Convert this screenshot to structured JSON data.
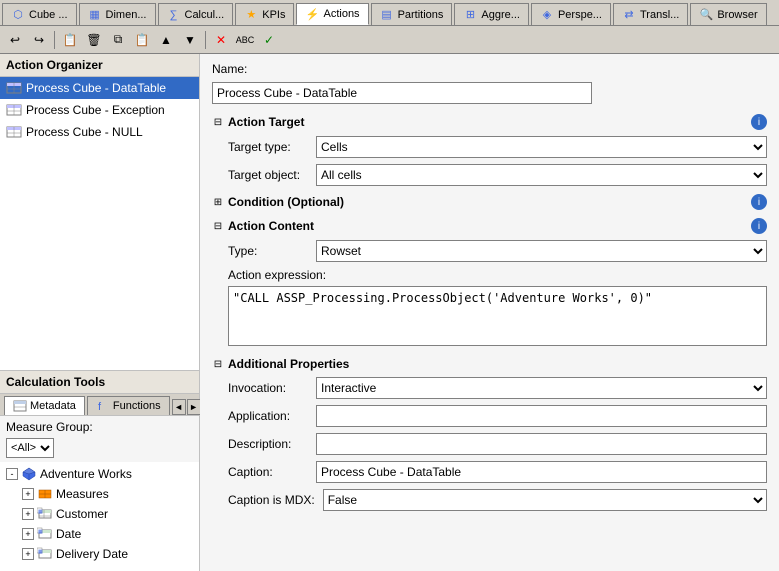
{
  "tabs": [
    {
      "label": "Cube ...",
      "icon": "cube",
      "active": false
    },
    {
      "label": "Dimen...",
      "icon": "dimension",
      "active": false
    },
    {
      "label": "Calcul...",
      "icon": "calculation",
      "active": false
    },
    {
      "label": "KPIs",
      "icon": "kpi",
      "active": false
    },
    {
      "label": "Actions",
      "icon": "action",
      "active": true
    },
    {
      "label": "Partitions",
      "icon": "partition",
      "active": false
    },
    {
      "label": "Aggre...",
      "icon": "aggregate",
      "active": false
    },
    {
      "label": "Perspe...",
      "icon": "perspective",
      "active": false
    },
    {
      "label": "Transl...",
      "icon": "translation",
      "active": false
    },
    {
      "label": "Browser",
      "icon": "browser",
      "active": false
    }
  ],
  "toolbar": {
    "buttons": [
      "↩",
      "↪",
      "📋",
      "✂",
      "📄",
      "📋",
      "🔍",
      "✕",
      "ABC"
    ]
  },
  "left_panel": {
    "organizer_title": "Action Organizer",
    "actions": [
      {
        "label": "Process Cube - DataTable",
        "selected": true
      },
      {
        "label": "Process Cube - Exception",
        "selected": false
      },
      {
        "label": "Process Cube - NULL",
        "selected": false
      }
    ],
    "calc_tools_title": "Calculation Tools",
    "calc_tabs": [
      {
        "label": "Metadata",
        "active": true,
        "icon": "metadata"
      },
      {
        "label": "Functions",
        "active": false,
        "icon": "functions"
      }
    ],
    "measure_group_label": "Measure Group:",
    "measure_group_value": "<All>",
    "tree_items": [
      {
        "label": "Adventure Works",
        "level": 0,
        "icon": "cube",
        "expandable": true,
        "expanded": true
      },
      {
        "label": "Measures",
        "level": 1,
        "icon": "measures",
        "expandable": true,
        "expanded": false
      },
      {
        "label": "Customer",
        "level": 1,
        "icon": "dimension",
        "expandable": true,
        "expanded": false
      },
      {
        "label": "Date",
        "level": 1,
        "icon": "dimension",
        "expandable": true,
        "expanded": false
      },
      {
        "label": "Delivery Date",
        "level": 1,
        "icon": "dimension",
        "expandable": true,
        "expanded": false
      }
    ]
  },
  "right_panel": {
    "name_label": "Name:",
    "name_value": "Process Cube - DataTable",
    "sections": {
      "action_target": {
        "title": "Action Target",
        "target_type_label": "Target type:",
        "target_type_value": "Cells",
        "target_object_label": "Target object:",
        "target_object_value": "All cells"
      },
      "condition": {
        "title": "Condition (Optional)"
      },
      "action_content": {
        "title": "Action Content",
        "type_label": "Type:",
        "type_value": "Rowset",
        "expression_label": "Action expression:",
        "expression_value": "\"CALL ASSP_Processing.ProcessObject('Adventure Works', 0)\""
      },
      "additional_properties": {
        "title": "Additional Properties",
        "invocation_label": "Invocation:",
        "invocation_value": "Interactive",
        "application_label": "Application:",
        "application_value": "",
        "description_label": "Description:",
        "description_value": "",
        "caption_label": "Caption:",
        "caption_value": "Process Cube - DataTable",
        "caption_mdx_label": "Caption is MDX:",
        "caption_mdx_value": "False"
      }
    }
  }
}
